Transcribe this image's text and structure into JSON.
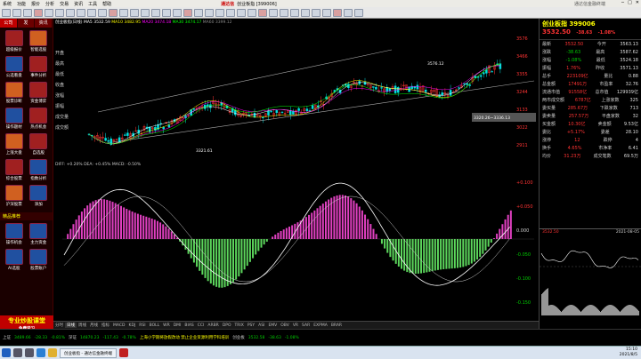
{
  "menubar": {
    "items": [
      "系统",
      "功能",
      "报价",
      "分析",
      "交易",
      "资讯",
      "工具",
      "帮助"
    ],
    "brand": "通达信",
    "window_title": "创业板指 [399006]",
    "right_text": "通达信金融终端"
  },
  "leftnav": {
    "tabs": [
      "公司",
      "发",
      "资讯"
    ],
    "items": [
      {
        "label": "超级报价",
        "icon": "quote-icon"
      },
      {
        "label": "智能选股",
        "icon": "filter-icon"
      },
      {
        "label": "公选看盘",
        "icon": "screen-icon"
      },
      {
        "label": "事件分析",
        "icon": "event-icon"
      },
      {
        "label": "股票诊断",
        "icon": "diagnose-icon"
      },
      {
        "label": "资金博弈",
        "icon": "fund-icon"
      },
      {
        "label": "操作题材",
        "icon": "theme-icon"
      },
      {
        "label": "热点机会",
        "icon": "hot-icon"
      },
      {
        "label": "上涨大盘",
        "icon": "rise-icon"
      },
      {
        "label": "自选股",
        "icon": "star-icon"
      },
      {
        "label": "综合股票",
        "icon": "stock-icon"
      },
      {
        "label": "指数分析",
        "icon": "index-icon"
      },
      {
        "label": "沪深股票",
        "icon": "market-icon"
      },
      {
        "label": "添加",
        "icon": "plus-icon"
      }
    ],
    "section2": "精品推荐",
    "items2": [
      {
        "label": "操作机会",
        "icon": "opportunity-icon"
      },
      {
        "label": "主力资金",
        "icon": "capital-icon"
      },
      {
        "label": "AI选股",
        "icon": "ai-icon"
      },
      {
        "label": "股票账户",
        "icon": "account-icon"
      }
    ],
    "promo_title": "专业炒股课堂",
    "promo_sub": "免费学习"
  },
  "chart_header": {
    "title": "创业板指(日线)",
    "ma_labels": [
      "MA5 3532.59",
      "MA10 3482.95",
      "MA20 3474.18",
      "MA30 3474.17",
      "MA60 3399.12"
    ],
    "high_label": "3576.12",
    "low_label": "3321.61",
    "box_label": "3320.26~3336.13"
  },
  "left_axis_labels": [
    "开盘",
    "最高",
    "最低",
    "收盘",
    "涨幅",
    "振幅",
    "成交量",
    "成交额"
  ],
  "right_axis_k": [
    "3576",
    "3466",
    "3355",
    "3244",
    "3133",
    "3022",
    "2911"
  ],
  "right_axis_osc": [
    "+0.100",
    "+0.050",
    "0.000",
    "-0.050",
    "-0.100",
    "-0.150"
  ],
  "osc_info": "DIFF: +0.20% DEA: +0.45% MACD: -0.50%",
  "bottom_tabs": [
    "分时",
    "日线",
    "周线",
    "月线",
    "指标",
    "MACD",
    "KDJ",
    "RSI",
    "BOLL",
    "WR",
    "DMI",
    "BIAS",
    "CCI",
    "ARBR",
    "DPO",
    "TRIX",
    "PSY",
    "ASI",
    "EMV",
    "OBV",
    "VR",
    "SAR",
    "EXPMA",
    "BRAR"
  ],
  "statusbar": {
    "sh_label": "上证",
    "sh_value": "3489.66",
    "sh_change": "-28.33",
    "sh_pct": "-0.81%",
    "sz_label": "深证",
    "sz_value": "14870.23",
    "sz_change": "-117.43",
    "sz_pct": "-0.78%",
    "cyb_label": "创业板",
    "cyb_value": "3532.58",
    "cyb_change": "-38.63",
    "cyb_pct": "-1.08%",
    "news": "上海小学期将放假改动 禁止企业资源利用学科培训"
  },
  "rightpanel": {
    "name": "创业板指 399006",
    "price": "3532.50",
    "change": "-38.63",
    "pct": "-1.08%",
    "rows": [
      {
        "l": "最新",
        "v": "3532.50",
        "l2": "今开",
        "v2": "3563.13"
      },
      {
        "l": "涨跌",
        "v": "-38.63",
        "l2": "最高",
        "v2": "3587.62"
      },
      {
        "l": "涨幅",
        "v": "-1.08%",
        "l2": "最低",
        "v2": "3524.18"
      },
      {
        "l": "振幅",
        "v": "1.76%",
        "l2": "昨收",
        "v2": "3571.13"
      },
      {
        "l": "总手",
        "v": "223109亿",
        "l2": "量比",
        "v2": "0.88"
      },
      {
        "l": "总金额",
        "v": "17491万",
        "l2": "市盈率",
        "v2": "32.76"
      },
      {
        "l": "流通市值",
        "v": "91558亿",
        "l2": "总市值",
        "v2": "129939亿"
      },
      {
        "l": "两市成交额",
        "v": "6787亿",
        "l2": "上涨家数",
        "v2": "325"
      },
      {
        "l": "委买量",
        "v": "285.67万",
        "l2": "下跌家数",
        "v2": "713"
      },
      {
        "l": "委卖量",
        "v": "257.57万",
        "l2": "平盘家数",
        "v2": "32"
      },
      {
        "l": "买金额",
        "v": "10.30亿",
        "l2": "卖金额",
        "v2": "9.53亿"
      },
      {
        "l": "委比",
        "v": "+5.17%",
        "l2": "委差",
        "v2": "28.10"
      },
      {
        "l": "涨停",
        "v": "12",
        "l2": "跌停",
        "v2": "4"
      },
      {
        "l": "换手",
        "v": "4.65%",
        "l2": "市净率",
        "v2": "6.41"
      },
      {
        "l": "均价",
        "v": "31.23万",
        "l2": "成交笔数",
        "v2": "69.5万"
      }
    ],
    "mini_title": "3532.50",
    "mini_date": "2021-08-05"
  },
  "taskbar": {
    "task_label": "创业板指 - 通达信金融终端",
    "time": "15:10",
    "date": "2021/8/5"
  },
  "colors": {
    "up": "#ff3333",
    "down": "#00cc00",
    "macd_pos": "#e040c0",
    "macd_neg": "#5cd65c"
  }
}
